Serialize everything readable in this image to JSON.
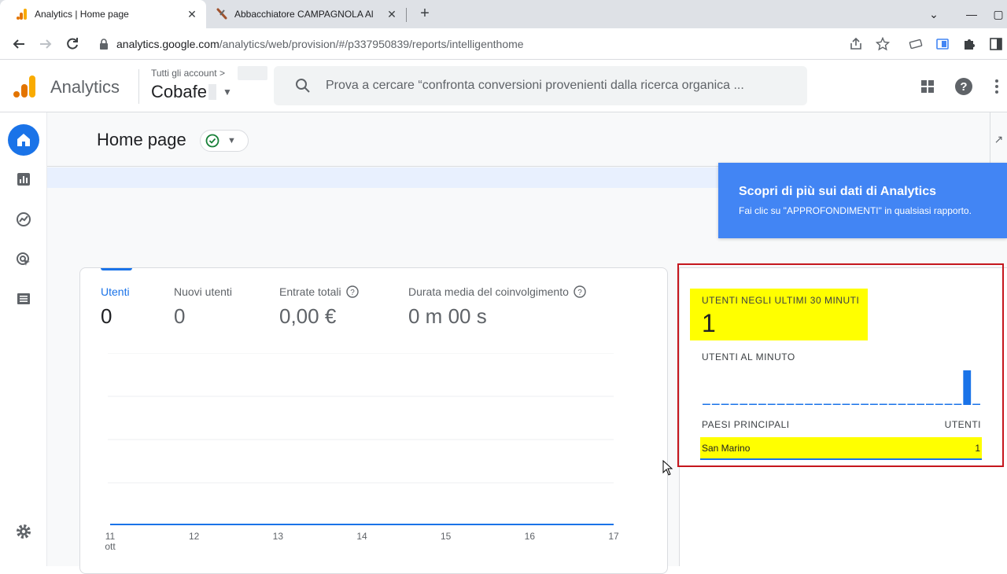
{
  "browser": {
    "tabs": [
      {
        "title": "Analytics | Home page",
        "active": true
      },
      {
        "title": "Abbacchiatore CAMPAGNOLA Al",
        "active": false
      }
    ],
    "url_host": "analytics.google.com",
    "url_path": "/analytics/web/provision/#/p337950839/reports/intelligenthome"
  },
  "header": {
    "product": "Analytics",
    "account_breadcrumb": "Tutti gli account",
    "property_name": "Cobafe",
    "search_placeholder": "Prova a cercare “confronta conversioni provenienti dalla ricerca organica ..."
  },
  "page": {
    "title": "Home page"
  },
  "metrics": [
    {
      "label": "Utenti",
      "value": "0",
      "selected": true
    },
    {
      "label": "Nuovi utenti",
      "value": "0",
      "selected": false
    },
    {
      "label": "Entrate totali",
      "value": "0,00 €",
      "selected": false
    },
    {
      "label": "Durata media del coinvolgimento",
      "value": "0 m 00 s",
      "selected": false
    }
  ],
  "chart_data": {
    "type": "line",
    "x": [
      "11",
      "12",
      "13",
      "14",
      "15",
      "16",
      "17"
    ],
    "x_sublabel": "ott",
    "series": [
      {
        "values": [
          0,
          0,
          0,
          0,
          0,
          0,
          0
        ]
      }
    ],
    "title": "",
    "xlabel": "",
    "ylabel": "",
    "grid": true,
    "colors": {
      "line": "#1a73e8"
    }
  },
  "realtime": {
    "users_30min_label": "UTENTI NEGLI ULTIMI 30 MINUTI",
    "users_30min_value": "1",
    "per_minute_label": "UTENTI AL MINUTO",
    "per_minute_values": [
      0,
      0,
      0,
      0,
      0,
      0,
      0,
      0,
      0,
      0,
      0,
      0,
      0,
      0,
      0,
      0,
      0,
      0,
      0,
      0,
      0,
      0,
      0,
      0,
      0,
      0,
      0,
      0,
      1,
      0
    ],
    "table_header_country": "PAESI PRINCIPALI",
    "table_header_users": "UTENTI",
    "rows": [
      {
        "country": "San Marino",
        "users": "1"
      }
    ]
  },
  "toast": {
    "title": "Scopri di più sui dati di Analytics",
    "body": "Fai clic su \"APPROFONDIMENTI\" in qualsiasi rapporto."
  },
  "colors": {
    "accent": "#1a73e8",
    "highlight": "#ffff00",
    "annotation_border": "#c5161d",
    "toast_bg": "#4285f4"
  }
}
